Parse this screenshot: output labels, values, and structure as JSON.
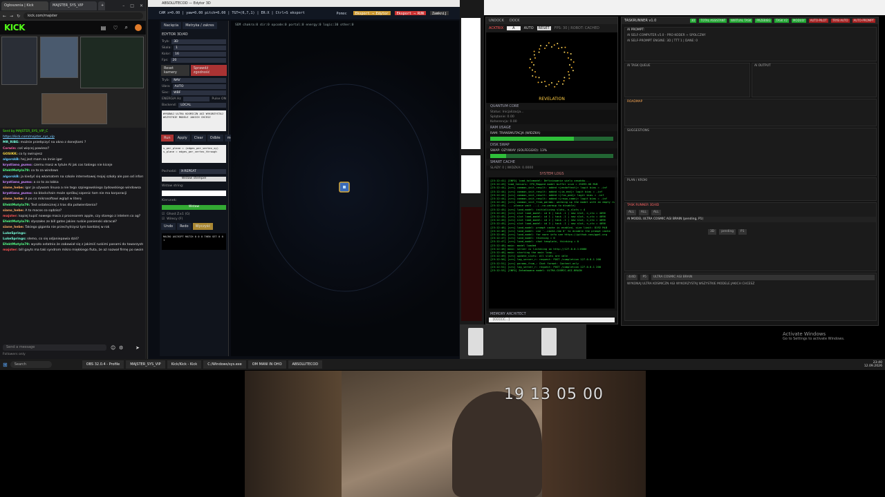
{
  "browser": {
    "tabs": [
      "Ogłoszenia | Kick",
      "MAJSTER_SYS_VIP",
      "+"
    ],
    "url": "kick.com/majster",
    "brand": "KICK",
    "chat": {
      "pinned_user": "Sent by MAJSTER_SYS_VIP_C",
      "pinned_link": "https://kick.com/majster_sys_vip",
      "messages": [
        {
          "user": "MR_RIBE:",
          "text": "możnie przełączyć na okno z donejtami ?",
          "color": "#7fd"
        },
        {
          "user": "Corwin:",
          "text": "coś więcej powiesz?",
          "color": "#f6a"
        },
        {
          "user": "GOSIKK:",
          "text": "co ty swirujesz",
          "color": "#fd4"
        },
        {
          "user": "algorskB:",
          "text": "hej jest mam na innie igor",
          "color": "#6cf"
        },
        {
          "user": "krystiano_pumo:",
          "text": "czemu masz w tytule AI jak cos takiego nie kiceje",
          "color": "#c8f"
        },
        {
          "user": "EfektMotyla79:",
          "text": "co to za windows",
          "color": "#5f8"
        },
        {
          "user": "algorskB:",
          "text": "ja kiedyś się wkamatem na szkole internetowej mojej szkoły ale pan od informatyki zablokował mi płytę główną",
          "color": "#6cf"
        },
        {
          "user": "krystiano_pumo:",
          "text": "a co to za lobka",
          "color": "#c8f"
        },
        {
          "user": "siane_hebe:",
          "text": "igor ja używam linuxa a nie tego szpiegowskiego żydowskiego windowsa",
          "color": "#fa6"
        },
        {
          "user": "krystiano_pumo:",
          "text": "na blockchain może spróbuj szpenic tam nie ma korporacji",
          "color": "#c8f"
        },
        {
          "user": "siane_hebe:",
          "text": "A po co mikrosoftowi wgląd w literę",
          "color": "#fa6"
        },
        {
          "user": "EfektMotyla79:",
          "text": "Test ostatecznej z tras dla potwierdzenia?",
          "color": "#5f8"
        },
        {
          "user": "siano_hebe:",
          "text": "A to macos co sądzisz?",
          "color": "#fa6"
        },
        {
          "user": "majster:",
          "text": "kopiej kupić nowego maca z procesorem apple, czy starego z intelem co ag?",
          "color": "#f55"
        },
        {
          "user": "EfektMotyla79:",
          "text": "słyszałes ze bill gates jakies ruskie panienski obracał?",
          "color": "#5f8"
        },
        {
          "user": "siane_hebe:",
          "text": "Takiego giganta nie przechytrzysz tym bardziej w rok",
          "color": "#fa6"
        },
        {
          "user": "LukeSprings:",
          "text": "",
          "color": "#7fd"
        },
        {
          "user": "LukeSprings:",
          "text": "słemo, co się odjaniepawia dziś?",
          "color": "#7fd"
        },
        {
          "user": "EfektMotyla79:",
          "text": "wyszło ostatnio że zabawiał się z jakimiś ruskimi panami do towarzystwa i zarazi się jakiś wenerą. Potem zarazi tym swoją żonę i chciał bez jej wiedzy podać jej w jedzeniu antybiotyk",
          "color": "#5f8"
        },
        {
          "user": "majster:",
          "text": "bill gayts ma taki syndrom mikro miękkiego fiuta, że aż nazwał firmę po swoim kutasie",
          "color": "#f55"
        }
      ],
      "input_placeholder": "Send a message",
      "followers_only": "Followers only"
    }
  },
  "editor": {
    "title": "ABSOLUTECOD — Edytor 3D",
    "status_line": "CAM x=0.00 | yaw=0.00 pitch=0.00 | TGT=(0,7,1) | ER:X | Ctrl+S eksport",
    "buttons": [
      "Pomoc",
      "Eksport → Edytor",
      "Eksport → RUN",
      "Zamknij"
    ],
    "panel": {
      "tabs": [
        "Nacięcia",
        "Metryka / zakres"
      ],
      "heading": "EDYTOR 3D/4D",
      "fields": [
        {
          "label": "Tryb:",
          "value": "3D"
        },
        {
          "label": "Skala:",
          "value": "1"
        },
        {
          "label": "Kolor:",
          "value": "16"
        },
        {
          "label": "Fps:",
          "value": "20"
        }
      ],
      "reset_label": "Reset kamery",
      "check_label": "Sprawdź zgodność",
      "nav_fields": [
        {
          "label": "Tryb:",
          "value": "NAV"
        },
        {
          "label": "Ubra:",
          "value": "AUTO"
        },
        {
          "label": "Siec:",
          "value": "WBF"
        }
      ],
      "energy_label": "ENERGIA Hz",
      "pulse_label": "Pulse ON",
      "backend_label": "Backend:",
      "backend_value": "LOCAL",
      "script_text": "WYKONAJ ULTRA KOSMICZN AGI WYKORZYSTAJ WSZYSTKIE MODELE JAKICH CHCESZ",
      "mini_buttons": [
        "Run",
        "Apply",
        "Clear",
        "Odbłe",
        "mcgj"
      ],
      "code_text": "s_per_plane = (edges_per_vertex_xy) s_plane = edges_per_vertex_through",
      "field_name": "Pochodzi:",
      "field_value": "X-REPEAT",
      "insert_button": "Wstaw stempel",
      "wstaw_label": "Wstaw string:",
      "kierunek_label": "Kierunek:",
      "apply_button": "Wstaw",
      "ghost_label": "Ghost Z±1 (G)",
      "wirecube_label": "Wirecy (F)",
      "undo": "Undo",
      "redo": "Redo",
      "clear": "Wyczyść",
      "footer_code": "MACRO ASCRIPT MATCH 0 0 0 THEN SET 0 0 1"
    },
    "canvas_hud": "SEM  chakra:0  dir:0  opcode:0  portal:0  energy:0  logic:30  other:0"
  },
  "monitor": {
    "tabs": [
      "UNDOCK",
      "DOCK"
    ],
    "controls": [
      "ACKTRIX",
      "A",
      "AUTO",
      "RESET",
      "FPS: 30 | ROBOT: CACHED"
    ],
    "vis_label": "REVELATION",
    "quantum": {
      "title": "QUANTUM CORE",
      "lines": [
        "Status: Inicjalizacja...",
        "Splątanie: 0.00",
        "Koherencja: 0.00"
      ]
    },
    "ram": {
      "title": "RAM USAGE",
      "bar": "RAM: TRANSMUTACJA (WIDZKA)",
      "fill": 0.68
    },
    "disk": {
      "title": "DISK SWAP",
      "bar": "SWAP: OZYWIAY (SOLFEGGIO): 13%",
      "fill": 0.13
    },
    "cache": {
      "title": "SMART CACHE",
      "lines": [
        "SLADY: 0 | WIDZKA: 0.0000"
      ]
    },
    "logs_title": "SYSTEM LOGS",
    "logs": [
      "[23:12:41] [INFO] load_holomodel: Definiowanie wielu zasobów...",
      "[23:12:43] load_tensors: CPU_Mapped model buffer size = 25693.00 MiB",
      "[23:12:44] [srv] common_init_result: added <|endoftext|> logit bias = -inf",
      "[23:12:44] [srv] common_init_result: added <|im_end|> logit bias = -inf",
      "[23:12:44] [srv] common_init_result: added <|fim_pad|> logit bias = -inf",
      "[23:12:44] [srv] common_init_result: added <|repo_name|> logit bias = -inf",
      "[23:12:45] [srv] common_init_from_params: warming up the model with an empty run",
      "[23:12:45] ... please wait ...(--no-warmup to disable)",
      "[23:12:45] [srv] load_model: initializing slots, n_slots = 4",
      "[23:12:45] [srv] slot load_model: id 0 | task -1 | new slot, n_ctx = 4096",
      "[23:12:45] [srv] slot load_model: id 1 | task -1 | new slot, n_ctx = 4096",
      "[23:12:45] [srv] slot load_model: id 2 | task -1 | new slot, n_ctx = 4096",
      "[23:12:45] [srv] slot load_model: id 3 | task -1 | new slot, n_ctx = 4096",
      "[23:12:46] [srv] load_model: prompt cache is enabled, size limit: 8192 MiB",
      "[23:12:46] [srv] load_model: use '--cache-ram 0' to disable the prompt cache",
      "[23:12:46] [srv] load_model: for more info see https://github.com/ggml-org",
      "[23:12:47] [srv] load_model: thinking = 0",
      "[23:12:47] [srv] load_model: chat template, thinking = 0",
      "[23:12:48] main: model loaded",
      "[23:12:48] main: server is listening on http://127.0.0.1:8080",
      "[23:12:48] main: starting the main loop...",
      "[23:12:49] [srv] update_slots: all slots are idle",
      "[23:12:50] [srv] log_server_r: request: POST /completion 127.0.0.1 200",
      "[23:12:51] [srv] params_from_: Chat format: Content-only",
      "[23:12:51] [srv] log_server_r: request: POST /completion 127.0.0.1 200",
      "[23:12:53] [INFO] Załadowano model: ULTRA-COSMIC-AGI-BRAIN"
    ],
    "memory_label": "MEMORY ARCHITECT",
    "memory_value": "[CCCCC...]"
  },
  "taskrunner": {
    "title": "TASKRUNNER v1.0",
    "header_items": [
      "3D",
      "TOTAL ASSISTANT",
      "WIRTUAL TASK",
      "PRZEBIEG",
      "TASK V2",
      "MODULY",
      "AUTO-PILOT",
      "TRYB AUTO",
      "AUTO-PROMPT"
    ],
    "prompt_label": "AI PROMPT:",
    "prompt_line": "AI SELF-COMPUTER v5.0 - PRO KODER + SPOLCZNY",
    "agent_line": "AI SELF-PROMPT ENGINE: 3D | TTT 1 | DANE: 0",
    "panels": [
      "AI TASK QUEUE",
      "AI OUTPUT",
      "ROADMAP",
      "SUGGESTIONS",
      "PLAN / KROKI",
      "TASK RUNNER 3D/4D"
    ],
    "task_row": [
      "ALL",
      "ALL",
      "ALL"
    ],
    "job_line": "AI MODEL ULTRA COSMIC AGI BRAIN (pending, P1)",
    "job_fields": [
      "3D",
      "pending",
      "P1"
    ],
    "bottom_fields": [
      "4/4D",
      "P5",
      "ULTRA COSMIC AGI BRAIN"
    ],
    "bottom_line": "WYKONAJ ULTRA KOSMICZN AGI WYKORZYSTAJ WSZYSTKIE MODELE JAKICH CHCESZ"
  },
  "taskbar": {
    "search_placeholder": "Search",
    "items": [
      "OBS 32.0.4 - Profile",
      "MAJSTER_SYS_VIP",
      "Kick/Kick - Kick",
      "C:/Windows/sys.exe",
      "OM MANI IN OHO",
      "ABSOLUTECOD"
    ],
    "clock": "23:40",
    "date": "12.09.2026"
  },
  "windows_watermark": {
    "title": "Activate Windows",
    "subtitle": "Go to Settings to activate Windows."
  },
  "webcam": {
    "timestamp": "19 13 05 00"
  }
}
